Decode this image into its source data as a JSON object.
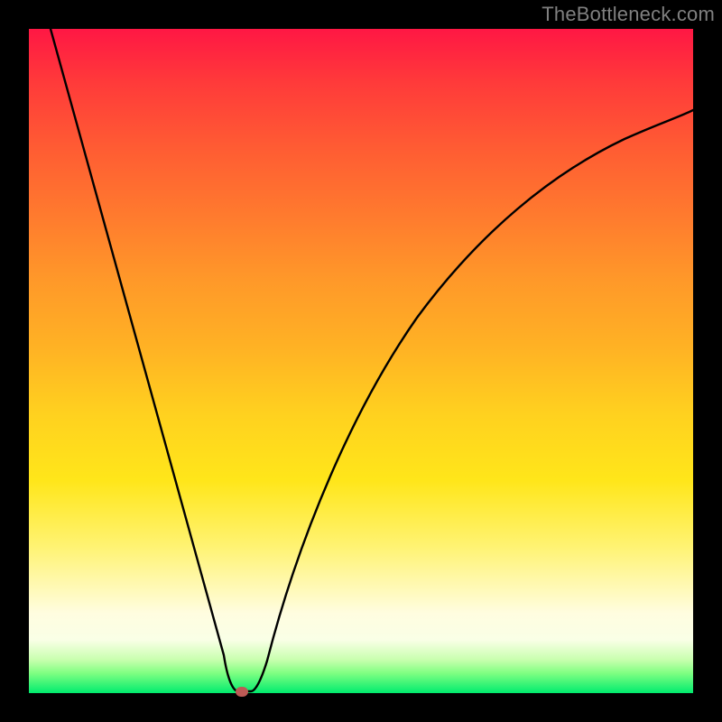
{
  "watermark": "TheBottleneck.com",
  "colors": {
    "frame": "#000000",
    "marker": "#bd5a55",
    "curve": "#000000"
  },
  "chart_data": {
    "type": "line",
    "title": "",
    "xlabel": "",
    "ylabel": "",
    "xlim": [
      0,
      100
    ],
    "ylim": [
      0,
      100
    ],
    "x": [
      0,
      3,
      6,
      9,
      12,
      15,
      18,
      21,
      24,
      27,
      30,
      31,
      32,
      33,
      34,
      38,
      42,
      46,
      50,
      55,
      60,
      65,
      70,
      75,
      80,
      85,
      90,
      95,
      100
    ],
    "values": [
      100,
      91,
      82,
      73,
      64,
      55,
      46,
      37,
      28,
      19,
      6,
      1,
      0,
      1,
      4,
      15,
      25,
      33,
      40,
      48,
      55,
      61,
      66,
      70,
      74,
      77,
      80,
      82,
      84
    ],
    "optimal_x": 32,
    "optimal_y": 0,
    "grid": false,
    "legend": false
  }
}
